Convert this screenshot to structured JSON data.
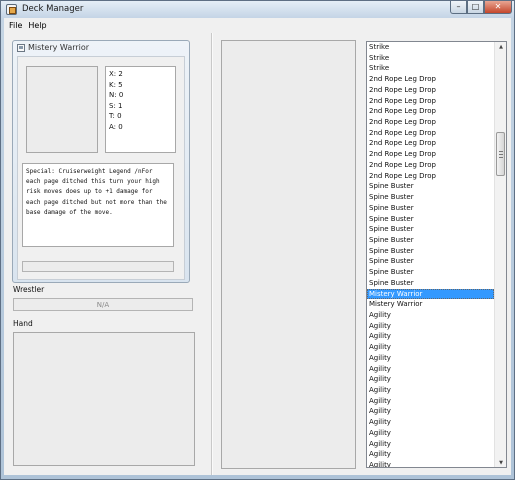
{
  "window": {
    "title": "Deck Manager",
    "minimize_glyph": "–",
    "maximize_glyph": "□",
    "close_glyph": "✕"
  },
  "menu": {
    "file": "File",
    "help": "Help"
  },
  "card": {
    "title": "Mistery Warrior",
    "stats": [
      "X: 2",
      "K: 5",
      "N: 0",
      "S: 1",
      "T: 0",
      "A: 0"
    ],
    "special": "Special: Cruiserweight Legend /nFor each page ditched this turn your high risk moves does up to +1 damage for each page ditched but not more than the base damage of the move."
  },
  "wrestler": {
    "label": "Wrestler",
    "value": "N/A"
  },
  "hand": {
    "label": "Hand"
  },
  "deck_list": {
    "selected_index": 23,
    "items": [
      "Strike",
      "Strike",
      "Strike",
      "2nd Rope Leg Drop",
      "2nd Rope Leg Drop",
      "2nd Rope Leg Drop",
      "2nd Rope Leg Drop",
      "2nd Rope Leg Drop",
      "2nd Rope Leg Drop",
      "2nd Rope Leg Drop",
      "2nd Rope Leg Drop",
      "2nd Rope Leg Drop",
      "2nd Rope Leg Drop",
      "Spine Buster",
      "Spine Buster",
      "Spine Buster",
      "Spine Buster",
      "Spine Buster",
      "Spine Buster",
      "Spine Buster",
      "Spine Buster",
      "Spine Buster",
      "Spine Buster",
      "Mistery Warrior",
      "Mistery Warrior",
      "Agility",
      "Agility",
      "Agility",
      "Agility",
      "Agility",
      "Agility",
      "Agility",
      "Agility",
      "Agility",
      "Agility",
      "Agility",
      "Agility",
      "Agility",
      "Agility",
      "Agility",
      "Agility"
    ]
  },
  "colors": {
    "selection": "#3399ff",
    "panel": "#f0f0f0",
    "titlebar": "#c4d4e6"
  }
}
